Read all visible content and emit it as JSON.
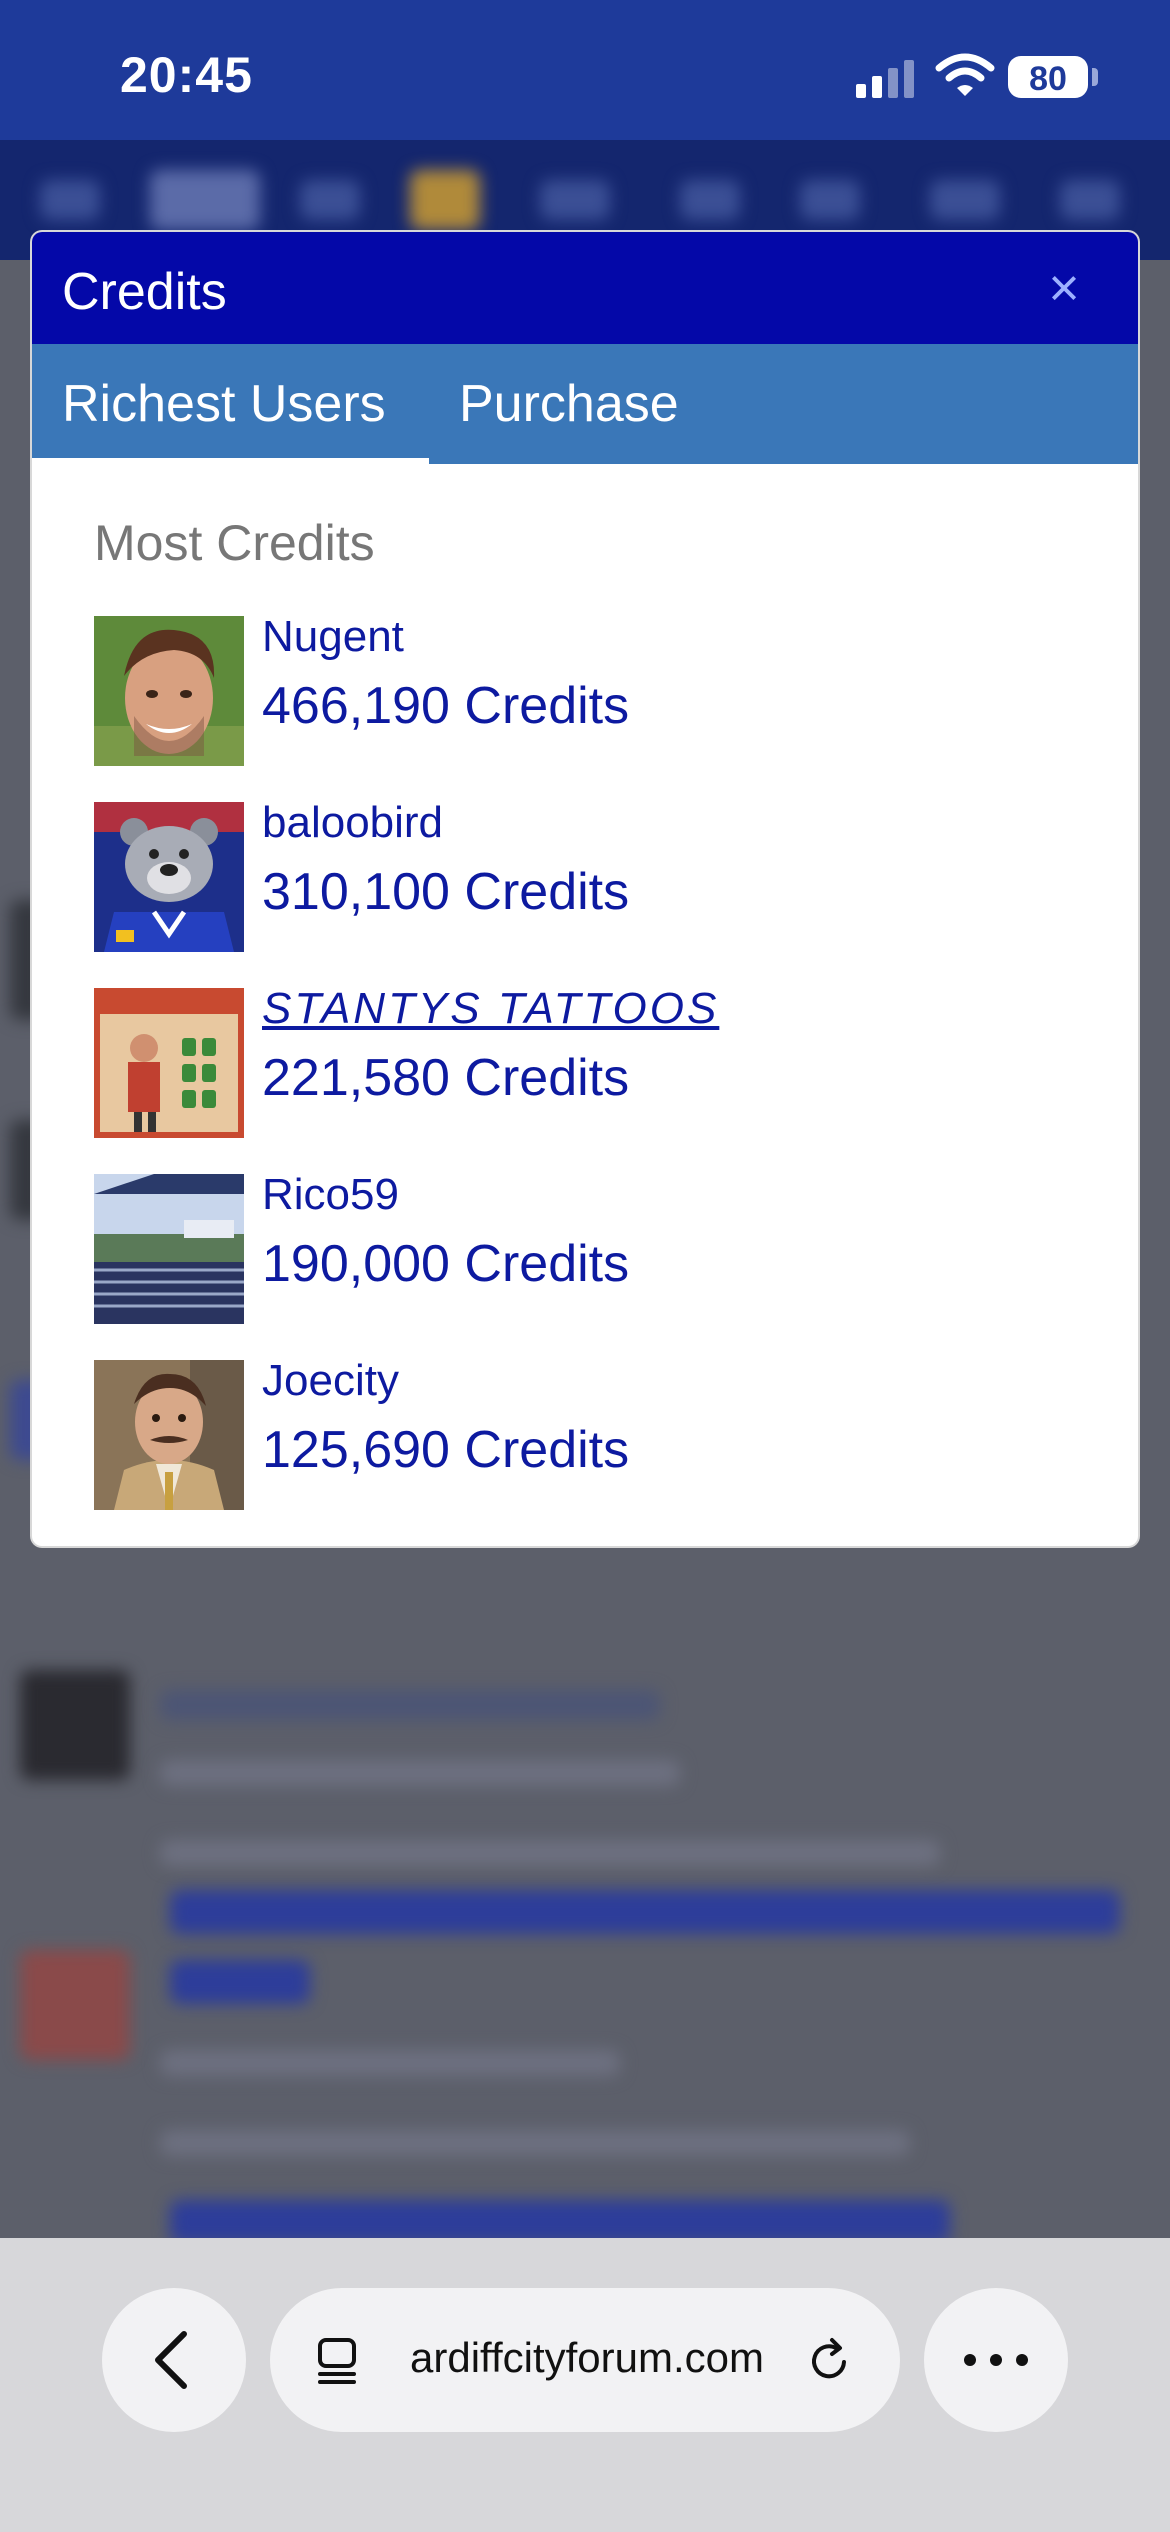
{
  "status_bar": {
    "time": "20:45",
    "battery": "80"
  },
  "modal": {
    "title": "Credits",
    "close_label": "×",
    "tabs": [
      {
        "label": "Richest Users",
        "active": true
      },
      {
        "label": "Purchase",
        "active": false
      }
    ],
    "section_heading": "Most Credits",
    "users": [
      {
        "name": "Nugent",
        "credits": "466,190 Credits"
      },
      {
        "name": "baloobird",
        "credits": "310,100 Credits"
      },
      {
        "name": "STANTYS TATTOOS",
        "credits": "221,580 Credits"
      },
      {
        "name": "Rico59",
        "credits": "190,000 Credits"
      },
      {
        "name": "Joecity",
        "credits": "125,690 Credits"
      }
    ]
  },
  "browser": {
    "url": "ardiffcityforum.com"
  },
  "colors": {
    "modal_header": "#0408a8",
    "tab_bar": "#3a77b8",
    "link": "#0d1aa0",
    "status_bar": "#1e3a9a"
  }
}
